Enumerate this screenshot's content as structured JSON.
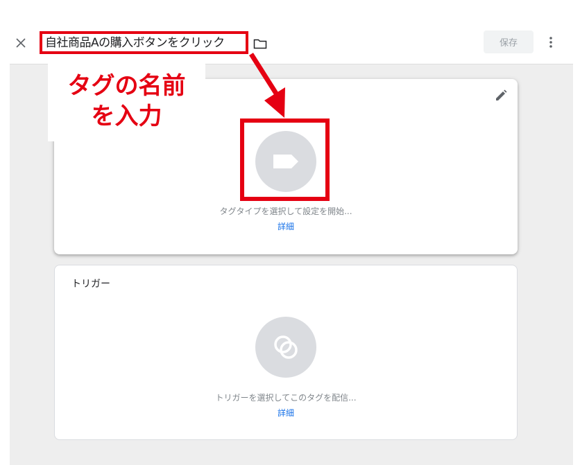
{
  "header": {
    "title": "自社商品Aの購入ボタンをクリック",
    "save_label": "保存"
  },
  "tag_card": {
    "hint": "タグタイプを選択して設定を開始...",
    "details_link": "詳細"
  },
  "trigger_card": {
    "title": "トリガー",
    "hint": "トリガーを選択してこのタグを配信...",
    "details_link": "詳細"
  },
  "annotation": {
    "line1": "タグの名前",
    "line2": "を入力"
  },
  "icons": {
    "close": "close-icon",
    "folder": "folder-icon",
    "more": "more-vert-icon",
    "edit": "pencil-icon",
    "tag": "tag-icon",
    "trigger": "trigger-icon"
  },
  "colors": {
    "annotation_red": "#e50012",
    "link_blue": "#1a73e8",
    "icon_circle": "#dadce0",
    "background_gray": "#eeeeee"
  }
}
